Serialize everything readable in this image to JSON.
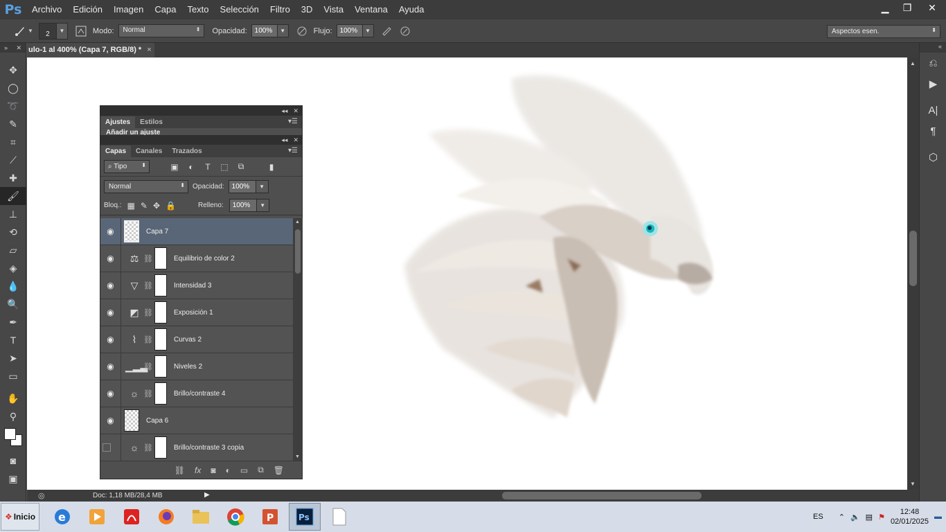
{
  "menu": {
    "logo": "Ps",
    "items": [
      "Archivo",
      "Edición",
      "Imagen",
      "Capa",
      "Texto",
      "Selección",
      "Filtro",
      "3D",
      "Vista",
      "Ventana",
      "Ayuda"
    ]
  },
  "options": {
    "brush_size": "2",
    "mode_label": "Modo:",
    "mode_value": "Normal",
    "opacity_label": "Opacidad:",
    "opacity_value": "100%",
    "flow_label": "Flujo:",
    "flow_value": "100%",
    "workspace": "Aspectos esen."
  },
  "document": {
    "tab_title": "ulo-1 al 400% (Capa 7, RGB/8) *",
    "close": "×",
    "status": "Doc: 1,18 MB/28,4 MB"
  },
  "adjustments_panel": {
    "tabs": [
      "Ajustes",
      "Estilos"
    ],
    "subtitle": "Añadir un ajuste"
  },
  "layers_panel": {
    "tabs": [
      "Capas",
      "Canales",
      "Trazados"
    ],
    "kind_filter": "Tipo",
    "blend_mode": "Normal",
    "opacity_label": "Opacidad:",
    "opacity_value": "100%",
    "lock_label": "Bloq.:",
    "fill_label": "Relleno:",
    "fill_value": "100%",
    "layers": [
      {
        "name": "Capa 7",
        "type": "pixel",
        "visible": true,
        "selected": true
      },
      {
        "name": "Equilibrio de color 2",
        "type": "adjustment",
        "icon": "balance-icon",
        "visible": true
      },
      {
        "name": "Intensidad 3",
        "type": "adjustment",
        "icon": "vibrance-icon",
        "visible": true
      },
      {
        "name": "Exposición 1",
        "type": "adjustment",
        "icon": "exposure-icon",
        "visible": true
      },
      {
        "name": "Curvas 2",
        "type": "adjustment",
        "icon": "curves-icon",
        "visible": true
      },
      {
        "name": "Niveles 2",
        "type": "adjustment",
        "icon": "levels-icon",
        "visible": true
      },
      {
        "name": "Brillo/contraste 4",
        "type": "adjustment",
        "icon": "brightness-icon",
        "visible": true
      },
      {
        "name": "Capa 6",
        "type": "pixel",
        "visible": true
      },
      {
        "name": "Brillo/contraste 3 copia",
        "type": "adjustment",
        "icon": "brightness-icon",
        "visible": false
      }
    ]
  },
  "taskbar": {
    "start_label": "Inicio",
    "language": "ES",
    "time": "12:48",
    "date": "02/01/2025"
  }
}
